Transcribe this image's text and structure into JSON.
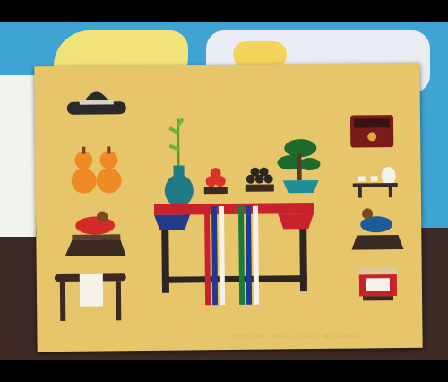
{
  "scene": {
    "subject": "illustrated postcard",
    "caption_text": "KOREAN TRADITIONAL WEDDING"
  },
  "colors": {
    "card": "#e7c56b",
    "map_sea": "#3fa3d4",
    "table_red": "#c8232c",
    "table_blue": "#233a8c",
    "dark": "#2d2520"
  },
  "icons": [
    "hat-icon",
    "gourd-icon",
    "rooster-icon",
    "stool-icon",
    "vase-bamboo-icon",
    "fruit-bowl-icon",
    "pine-bonsai-icon",
    "wedding-table-icon",
    "chest-icon",
    "cups-icon",
    "duck-icon",
    "bench-icon"
  ]
}
